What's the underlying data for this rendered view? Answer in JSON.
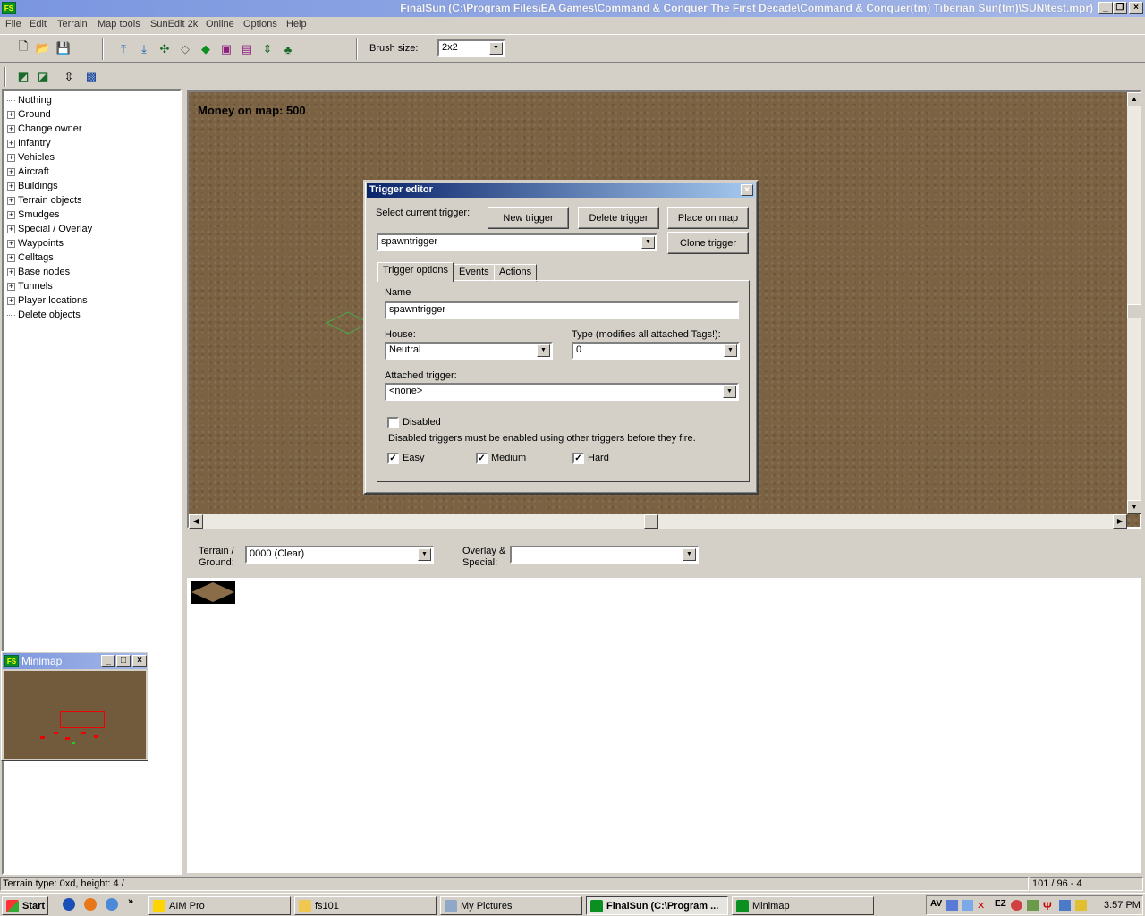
{
  "app": {
    "title": "FinalSun (C:\\Program Files\\EA Games\\Command & Conquer The First Decade\\Command & Conquer(tm) Tiberian Sun(tm)\\SUN\\test.mpr)",
    "icon_text": "FS"
  },
  "menu": [
    "File",
    "Edit",
    "Terrain",
    "Map tools",
    "SunEdit 2k",
    "Online",
    "Options",
    "Help"
  ],
  "toolbar": {
    "brush_label": "Brush size:",
    "brush_value": "2x2"
  },
  "tree": {
    "items": [
      {
        "label": "Nothing",
        "expandable": false
      },
      {
        "label": "Ground",
        "expandable": true
      },
      {
        "label": "Change owner",
        "expandable": true
      },
      {
        "label": "Infantry",
        "expandable": true
      },
      {
        "label": "Vehicles",
        "expandable": true
      },
      {
        "label": "Aircraft",
        "expandable": true
      },
      {
        "label": "Buildings",
        "expandable": true
      },
      {
        "label": "Terrain objects",
        "expandable": true
      },
      {
        "label": "Smudges",
        "expandable": true
      },
      {
        "label": "Special / Overlay",
        "expandable": true
      },
      {
        "label": "Waypoints",
        "expandable": true
      },
      {
        "label": "Celltags",
        "expandable": true
      },
      {
        "label": "Base nodes",
        "expandable": true
      },
      {
        "label": "Tunnels",
        "expandable": true
      },
      {
        "label": "Player locations",
        "expandable": true
      },
      {
        "label": "Delete objects",
        "expandable": false
      }
    ]
  },
  "map": {
    "money_text": "Money on map: 500"
  },
  "minimap": {
    "title": "Minimap"
  },
  "trigger_editor": {
    "title": "Trigger editor",
    "select_label": "Select current trigger:",
    "new_button": "New trigger",
    "delete_button": "Delete trigger",
    "place_button": "Place on map",
    "clone_button": "Clone trigger",
    "current_trigger": "spawntrigger",
    "tabs": [
      "Trigger options",
      "Events",
      "Actions"
    ],
    "name_label": "Name",
    "name_value": "spawntrigger",
    "house_label": "House:",
    "house_value": "Neutral",
    "type_label": "Type (modifies all attached Tags!):",
    "type_value": "0",
    "attached_label": "Attached trigger:",
    "attached_value": "<none>",
    "disabled_label": "Disabled",
    "disabled_checked": false,
    "disabled_note": "Disabled triggers must be enabled using other triggers before they fire.",
    "easy_label": "Easy",
    "medium_label": "Medium",
    "hard_label": "Hard"
  },
  "bottom": {
    "terrain_label_1": "Terrain /",
    "terrain_label_2": "Ground:",
    "terrain_value": "0000 (Clear)",
    "overlay_label_1": "Overlay &",
    "overlay_label_2": "Special:",
    "overlay_value": ""
  },
  "status": {
    "left": "Terrain type: 0xd, height: 4 /",
    "right": "101 / 96 - 4"
  },
  "taskbar": {
    "start": "Start",
    "tasks": [
      "AIM Pro",
      "fs101",
      "My Pictures",
      "FinalSun (C:\\Program ...",
      "Minimap"
    ],
    "tray_text": "AV",
    "tray_ez": "EZ",
    "clock": "3:57 PM"
  }
}
